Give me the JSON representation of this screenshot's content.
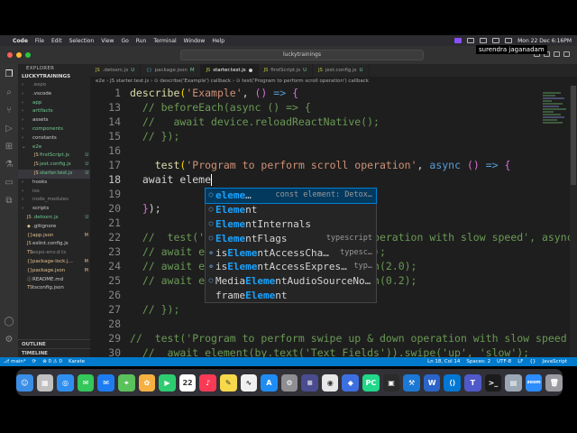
{
  "menubar": {
    "app_name": "Code",
    "items": [
      "File",
      "Edit",
      "Selection",
      "View",
      "Go",
      "Run",
      "Terminal",
      "Window",
      "Help"
    ],
    "clock": "Mon 22 Dec  6:16PM"
  },
  "titlebar": {
    "search_text": "luckytrainings"
  },
  "sidebar": {
    "header": "EXPLORER",
    "project": "LUCKYTRAININGS",
    "tree": [
      {
        "label": ".expo",
        "arrow": "›",
        "icon": "",
        "badge": "",
        "color": "c-gray",
        "indent": 1
      },
      {
        "label": ".vscode",
        "arrow": "›",
        "icon": "",
        "badge": "",
        "color": "",
        "indent": 1
      },
      {
        "label": "app",
        "arrow": "›",
        "icon": "",
        "badge": "",
        "color": "c-green",
        "indent": 1
      },
      {
        "label": "artifacts",
        "arrow": "›",
        "icon": "",
        "badge": "",
        "color": "c-green",
        "indent": 1
      },
      {
        "label": "assets",
        "arrow": "›",
        "icon": "",
        "badge": "",
        "color": "",
        "indent": 1
      },
      {
        "label": "components",
        "arrow": "›",
        "icon": "",
        "badge": "",
        "color": "c-green",
        "indent": 1
      },
      {
        "label": "constants",
        "arrow": "›",
        "icon": "",
        "badge": "",
        "color": "",
        "indent": 1
      },
      {
        "label": "e2e",
        "arrow": "⌄",
        "icon": "",
        "badge": "",
        "color": "c-green",
        "indent": 1
      },
      {
        "label": "firstScript.js",
        "arrow": "",
        "icon": "JS",
        "badge": "U",
        "color": "c-green",
        "indent": 2
      },
      {
        "label": "jest.config.js",
        "arrow": "",
        "icon": "JS",
        "badge": "U",
        "color": "c-green",
        "indent": 2
      },
      {
        "label": "starter.test.js",
        "arrow": "",
        "icon": "JS",
        "badge": "U",
        "color": "c-green",
        "indent": 2,
        "selected": true
      },
      {
        "label": "hooks",
        "arrow": "›",
        "icon": "",
        "badge": "",
        "color": "",
        "indent": 1
      },
      {
        "label": "ios",
        "arrow": "›",
        "icon": "",
        "badge": "",
        "color": "c-gray",
        "indent": 1
      },
      {
        "label": "node_modules",
        "arrow": "›",
        "icon": "",
        "badge": "",
        "color": "c-gray",
        "indent": 1
      },
      {
        "label": "scripts",
        "arrow": "›",
        "icon": "",
        "badge": "",
        "color": "",
        "indent": 1
      },
      {
        "label": ".detoxrc.js",
        "arrow": "",
        "icon": "JS",
        "badge": "U",
        "color": "c-green",
        "indent": 1
      },
      {
        "label": ".gitignore",
        "arrow": "",
        "icon": "◆",
        "badge": "",
        "color": "",
        "indent": 1
      },
      {
        "label": "app.json",
        "arrow": "",
        "icon": "{}",
        "badge": "M",
        "color": "c-yel",
        "indent": 1
      },
      {
        "label": "eslint.config.js",
        "arrow": "",
        "icon": "JS",
        "badge": "",
        "color": "",
        "indent": 1
      },
      {
        "label": "expo-env.d.ts",
        "arrow": "",
        "icon": "TS",
        "badge": "",
        "color": "c-gray",
        "indent": 1
      },
      {
        "label": "package-lock.j...",
        "arrow": "",
        "icon": "{}",
        "badge": "M",
        "color": "c-yel",
        "indent": 1
      },
      {
        "label": "package.json",
        "arrow": "",
        "icon": "{}",
        "badge": "M",
        "color": "c-yel",
        "indent": 1
      },
      {
        "label": "README.md",
        "arrow": "",
        "icon": "ⓘ",
        "badge": "",
        "color": "",
        "indent": 1
      },
      {
        "label": "tsconfig.json",
        "arrow": "",
        "icon": "TS",
        "badge": "",
        "color": "",
        "indent": 1
      }
    ],
    "outline": "OUTLINE",
    "timeline": "TIMELINE"
  },
  "tabs": [
    {
      "label": ".detoxrc.js",
      "badge": "U",
      "icon": "JS",
      "active": false
    },
    {
      "label": "package.json",
      "badge": "M",
      "icon": "{}",
      "active": false
    },
    {
      "label": "starter.test.js",
      "badge": "",
      "icon": "JS",
      "active": true
    },
    {
      "label": "firstScript.js",
      "badge": "U",
      "icon": "JS",
      "active": false
    },
    {
      "label": "jest.config.js",
      "badge": "U",
      "icon": "JS",
      "active": false
    }
  ],
  "breadcrumb": "e2e  ›  JS starter.test.js  ›  ⊙ describe('Example') callback  ›  ⊙ test('Program to perform scroll operation') callback",
  "user_tag": "surendra jaganadam",
  "code": [
    {
      "ln": "1",
      "html": "<span class=\"fn\">describe</span><span class=\"brk\">(</span><span class=\"str\">'Example'</span><span class=\"plain\">, </span><span class=\"brk2\">()</span><span class=\"kw\"> =&gt; </span><span class=\"brk2\">{</span>"
    },
    {
      "ln": "13",
      "html": "<span class=\"cmt\">  // beforeEach(async () =&gt; {</span>"
    },
    {
      "ln": "14",
      "html": "<span class=\"cmt\">  //   await device.reloadReactNative();</span>"
    },
    {
      "ln": "15",
      "html": "<span class=\"cmt\">  // });</span>"
    },
    {
      "ln": "16",
      "html": ""
    },
    {
      "ln": "17",
      "html": "<span class=\"plain\">    </span><span class=\"fn\">test</span><span class=\"brk\">(</span><span class=\"str\">'Program to perform scroll operation'</span><span class=\"plain\">, </span><span class=\"kw\">async</span><span class=\"plain\"> </span><span class=\"brk2\">()</span><span class=\"kw\"> =&gt; </span><span class=\"brk2\">{</span>"
    },
    {
      "ln": "18",
      "html": "<span class=\"plain\">  await eleme</span><span class=\"cursor\"></span>",
      "current": true
    },
    {
      "ln": "19",
      "html": ""
    },
    {
      "ln": "20",
      "html": "<span class=\"plain\">  </span><span class=\"brk2\">}</span><span class=\"plain\">);</span>"
    },
    {
      "ln": "21",
      "html": ""
    },
    {
      "ln": "22",
      "html": "<span class=\"cmt\">  //  test('Program to perform scroll operation with slow speed', async</span>"
    },
    {
      "ln": "23",
      "html": "<span class=\"cmt\">  // await element(by.id('pinch')).tap();</span>"
    },
    {
      "ln": "24",
      "html": "<span class=\"cmt\">  // await element(by.id('pinch')).pinch(2.0);</span>"
    },
    {
      "ln": "25",
      "html": "<span class=\"cmt\">  // await element(by.id('pinch')).pinch(0.2);</span>"
    },
    {
      "ln": "26",
      "html": ""
    },
    {
      "ln": "27",
      "html": "<span class=\"cmt\">  // });</span>"
    },
    {
      "ln": "28",
      "html": ""
    },
    {
      "ln": "29",
      "html": "<span class=\"cmt\">//  test('Program to perform swipe up &amp; down operation with slow speed</span>"
    },
    {
      "ln": "30",
      "html": "<span class=\"cmt\">  //  await element(by.text('Text Fields')).swipe('up', 'slow');</span>"
    }
  ],
  "suggestions": [
    {
      "label_pre": "",
      "match": "eleme",
      "label_post": "…",
      "detail": "const element: Detox…",
      "icon": "⬡",
      "selected": true
    },
    {
      "label_pre": "",
      "match": "Eleme",
      "label_post": "nt",
      "detail": "",
      "icon": "⬡"
    },
    {
      "label_pre": "",
      "match": "Eleme",
      "label_post": "ntInternals",
      "detail": "",
      "icon": "⬡"
    },
    {
      "label_pre": "",
      "match": "Eleme",
      "label_post": "ntFlags",
      "detail": "typescript",
      "icon": "⬡"
    },
    {
      "label_pre": "is",
      "match": "Eleme",
      "label_post": "ntAccessCha…",
      "detail": "typesc…",
      "icon": "⚙"
    },
    {
      "label_pre": "is",
      "match": "Eleme",
      "label_post": "ntAccessExpres…",
      "detail": "typ…",
      "icon": "⚙"
    },
    {
      "label_pre": "Media",
      "match": "Eleme",
      "label_post": "ntAudioSourceNo…",
      "detail": "",
      "icon": "⬡"
    },
    {
      "label_pre": "frame",
      "match": "Eleme",
      "label_post": "nt",
      "detail": "",
      "icon": ""
    }
  ],
  "statusbar": {
    "branch": "⎇ main*",
    "sync": "⟳",
    "errors": "⊗ 0 ⚠ 0",
    "karate": "Karate",
    "position": "Ln 18, Col 14",
    "spaces": "Spaces: 2",
    "encoding": "UTF-8",
    "eol": "LF",
    "braces": "{}",
    "language": "JavaScript"
  },
  "dock": [
    {
      "name": "finder",
      "glyph": "☺",
      "color": "#3a8ee6"
    },
    {
      "name": "launchpad",
      "glyph": "▦",
      "color": "#c0c0c0"
    },
    {
      "name": "safari",
      "glyph": "◎",
      "color": "#2f8ff0"
    },
    {
      "name": "messages",
      "glyph": "✉",
      "color": "#34c759"
    },
    {
      "name": "mail",
      "glyph": "✉",
      "color": "#1e7cf2"
    },
    {
      "name": "maps",
      "glyph": "⌖",
      "color": "#5bc25b"
    },
    {
      "name": "photos",
      "glyph": "✿",
      "color": "#f5b041"
    },
    {
      "name": "facetime",
      "glyph": "▶",
      "color": "#2ecc71"
    },
    {
      "name": "calendar",
      "glyph": "22",
      "color": "#ffffff"
    },
    {
      "name": "music",
      "glyph": "♪",
      "color": "#fa3a55"
    },
    {
      "name": "notes",
      "glyph": "✎",
      "color": "#f7d84a"
    },
    {
      "name": "freeform",
      "glyph": "∿",
      "color": "#f0f0f0"
    },
    {
      "name": "app-store",
      "glyph": "A",
      "color": "#1f8cf4"
    },
    {
      "name": "settings",
      "glyph": "⚙",
      "color": "#8e8e93"
    },
    {
      "name": "terminal-app",
      "glyph": "≡",
      "color": "#4b4b8f"
    },
    {
      "name": "chrome",
      "glyph": "◉",
      "color": "#e8e8e8"
    },
    {
      "name": "app-blue",
      "glyph": "◆",
      "color": "#3d6fe0"
    },
    {
      "name": "pycharm",
      "glyph": "PC",
      "color": "#21d789"
    },
    {
      "name": "app-dark",
      "glyph": "▣",
      "color": "#2b2b2b"
    },
    {
      "name": "xcode",
      "glyph": "⚒",
      "color": "#1c78d4"
    },
    {
      "name": "app-wave",
      "glyph": "W",
      "color": "#2a64c8"
    },
    {
      "name": "vscode",
      "glyph": "⟨⟩",
      "color": "#0078d4"
    },
    {
      "name": "teams",
      "glyph": "T",
      "color": "#5059c9"
    },
    {
      "name": "terminal",
      "glyph": ">_",
      "color": "#1b1b1b"
    },
    {
      "name": "preview",
      "glyph": "▤",
      "color": "#9aa7b5"
    },
    {
      "name": "zoom",
      "glyph": "zoom",
      "color": "#2d8cff"
    },
    {
      "name": "trash",
      "glyph": "🗑",
      "color": "#9a9aa0"
    }
  ]
}
